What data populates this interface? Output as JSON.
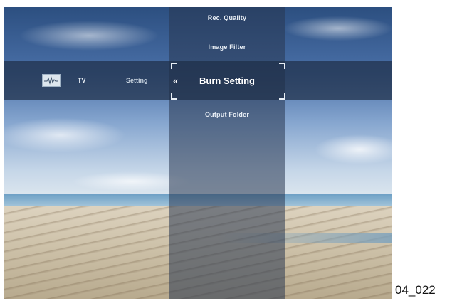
{
  "menu": {
    "items_above": [
      "Rec. Quality",
      "Image Filter"
    ],
    "selected": "Burn Setting",
    "items_below": [
      "Output Folder"
    ],
    "back_glyph": "«"
  },
  "breadcrumb": {
    "source": "TV",
    "section": "Setting"
  },
  "icons": {
    "source_icon": "tv-waveform-icon"
  },
  "caption": "04_022",
  "colors": {
    "overlay": "#283750",
    "text": "#e8eef5"
  }
}
